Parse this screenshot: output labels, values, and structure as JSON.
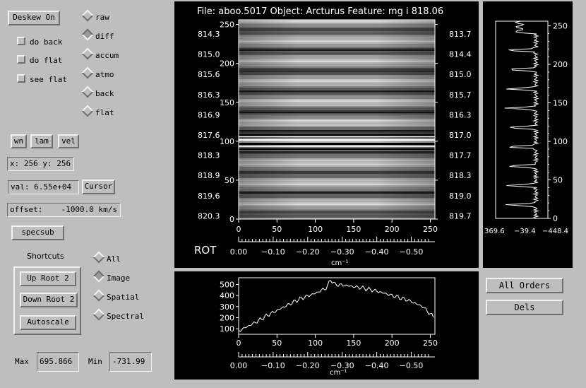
{
  "controls": {
    "deskew_label": "Deskew On",
    "checkboxes": [
      "do back",
      "do flat",
      "see flat"
    ],
    "display_modes": [
      {
        "label": "raw",
        "selected": false
      },
      {
        "label": "diff",
        "selected": true
      },
      {
        "label": "accum",
        "selected": false
      },
      {
        "label": "atmo",
        "selected": false
      },
      {
        "label": "back",
        "selected": false
      },
      {
        "label": "flat",
        "selected": false
      }
    ],
    "unit_buttons": [
      "wn",
      "lam",
      "vel"
    ],
    "xy_readout": "x: 256 y: 256",
    "val_readout": "val: 6.55e+04",
    "cursor_label": "Cursor",
    "offset_label": "offset:",
    "offset_value": "-1000.0 km/s",
    "specsub_label": "specsub",
    "shortcuts_title": "Shortcuts",
    "shortcut_buttons": [
      "Up Root 2",
      "Down Root 2",
      "Autoscale"
    ],
    "scope_options": [
      {
        "label": "All",
        "selected": false
      },
      {
        "label": "Image",
        "selected": true
      },
      {
        "label": "Spatial",
        "selected": false
      },
      {
        "label": "Spectral",
        "selected": false
      }
    ],
    "max_label": "Max",
    "max_value": "695.866",
    "min_label": "Min",
    "min_value": "-731.99",
    "all_orders_label": "All Orders",
    "dels_label": "Dels"
  },
  "image_panel": {
    "header": "File: aboo.5017   Object: Arcturus   Feature: mg i  818.06",
    "left_wavelengths": [
      "814.3",
      "815.0",
      "815.6",
      "816.3",
      "816.9",
      "817.6",
      "818.3",
      "818.9",
      "819.6",
      "820.3"
    ],
    "right_wavelengths": [
      "813.7",
      "814.4",
      "815.0",
      "815.7",
      "816.3",
      "817.0",
      "817.7",
      "818.3",
      "819.0",
      "819.7"
    ],
    "y_ticks": [
      "250",
      "200",
      "150",
      "100",
      "50",
      "0"
    ],
    "x_ticks": [
      "0",
      "50",
      "100",
      "150",
      "200",
      "250"
    ],
    "wn_ticks": [
      "0.00",
      "−0.10",
      "−0.20",
      "−0.30",
      "−0.40",
      "−0.50"
    ],
    "rot_label": "ROT",
    "unit_label": "cm⁻¹"
  },
  "spatial_panel": {
    "y_ticks": [
      "250",
      "200",
      "150",
      "100",
      "50",
      "0"
    ],
    "bottom_labels": [
      "369.6",
      "−39.4",
      "−448.4"
    ]
  },
  "spectral_panel": {
    "y_ticks": [
      "500",
      "400",
      "300",
      "200",
      "100"
    ],
    "x_ticks": [
      "0",
      "50",
      "100",
      "150",
      "200",
      "250"
    ],
    "wn_ticks": [
      "0.00",
      "−0.10",
      "−0.20",
      "−0.30",
      "−0.40",
      "−0.50"
    ],
    "unit_label": "cm⁻¹"
  },
  "chart_data": [
    {
      "type": "line",
      "description_of_axes": "spectral profile",
      "x": [
        0,
        20,
        40,
        60,
        80,
        100,
        115,
        120,
        125,
        140,
        160,
        180,
        200,
        220,
        240,
        255
      ],
      "values": [
        80,
        150,
        230,
        300,
        370,
        420,
        470,
        545,
        500,
        490,
        470,
        440,
        400,
        360,
        300,
        200
      ],
      "xlim": [
        0,
        255
      ],
      "ylim": [
        50,
        560
      ]
    }
  ]
}
